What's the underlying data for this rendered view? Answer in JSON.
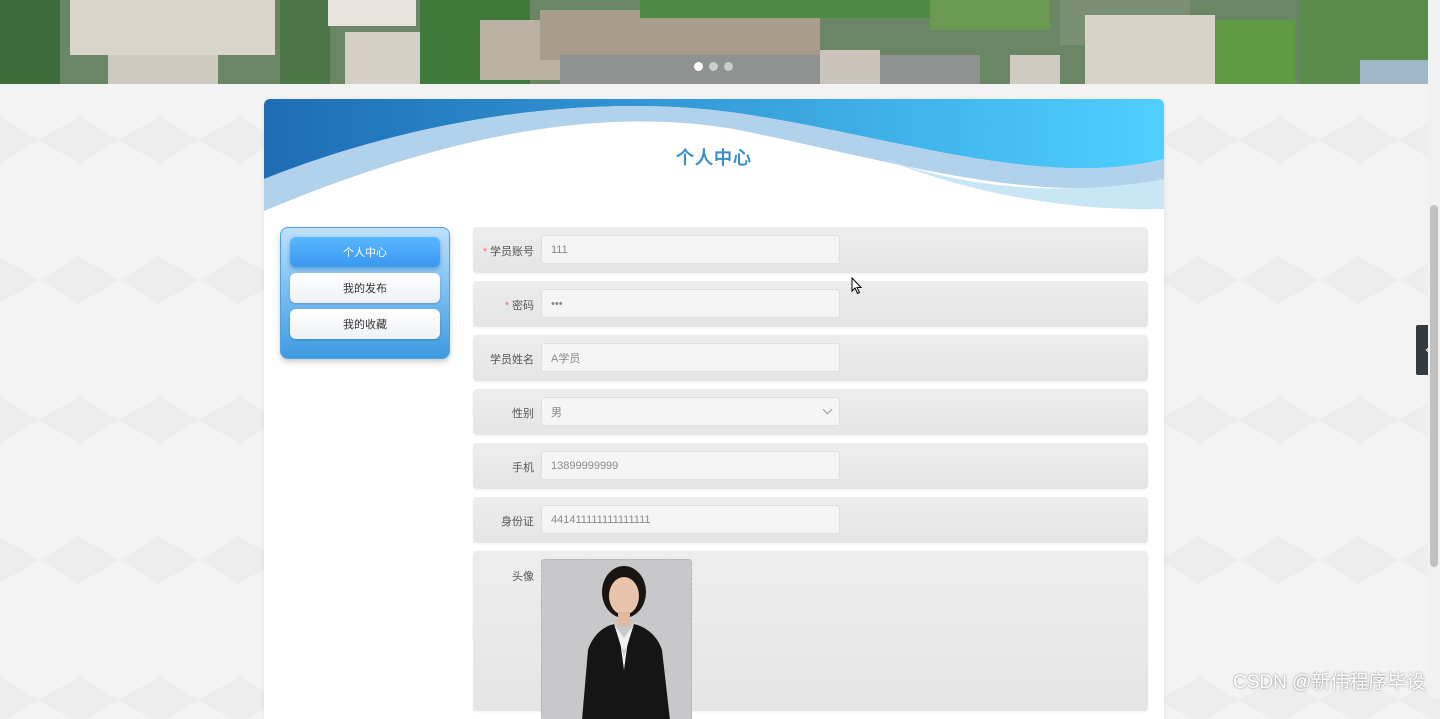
{
  "banner": {
    "slide_count": 3,
    "active_slide": 1
  },
  "page_title": "个人中心",
  "sidebar": {
    "items": [
      {
        "label": "个人中心",
        "active": true
      },
      {
        "label": "我的发布",
        "active": false
      },
      {
        "label": "我的收藏",
        "active": false
      }
    ]
  },
  "form": {
    "account": {
      "label": "学员账号",
      "required": true,
      "value": "111"
    },
    "password": {
      "label": "密码",
      "required": true,
      "value": "•••"
    },
    "name": {
      "label": "学员姓名",
      "required": false,
      "value": "A学员"
    },
    "gender": {
      "label": "性别",
      "required": false,
      "value": "男"
    },
    "phone": {
      "label": "手机",
      "required": false,
      "value": "13899999999"
    },
    "id_card": {
      "label": "身份证",
      "required": false,
      "value": "441411111111111111"
    },
    "avatar": {
      "label": "头像",
      "required": false
    }
  },
  "watermark": "CSDN @新伟程序毕设",
  "colors": {
    "title": "#3a8ec9",
    "active_button": "#3a97f0",
    "required_star": "#f56c6c"
  }
}
